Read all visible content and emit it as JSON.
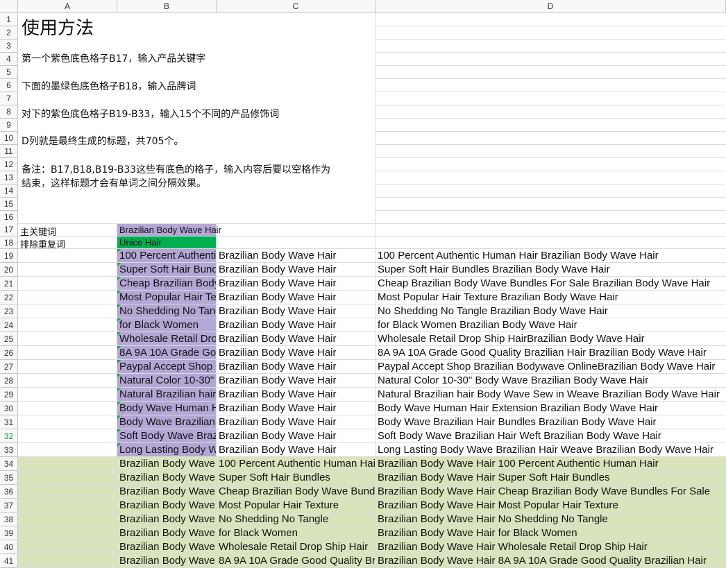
{
  "columns": [
    "A",
    "B",
    "C",
    "D"
  ],
  "rows": [
    1,
    2,
    3,
    4,
    5,
    6,
    7,
    8,
    9,
    10,
    11,
    12,
    13,
    14,
    15,
    16,
    17,
    18,
    19,
    20,
    21,
    22,
    23,
    24,
    25,
    26,
    27,
    28,
    29,
    30,
    31,
    32,
    33,
    34,
    35,
    36,
    37,
    38,
    39,
    40,
    41
  ],
  "active_row": 32,
  "colors": {
    "purple_fill": "#b4a7d6",
    "green_fill": "#00b050",
    "light_green_fill": "#d8e4bc",
    "grid": "#dadcdd",
    "header_bg": "#f8f8f8"
  },
  "instructions": {
    "title": "使用方法",
    "line1": "第一个紫色底色格子B17，输入产品关键字",
    "line2": "下面的墨绿色底色格子B18，输入品牌词",
    "line3": "对下的紫色底色格子B19-B33，输入15个不同的产品修饰词",
    "line4": "D列就是最终生成的标题，共705个。",
    "line5a": "备注：B17,B18,B19-B33这些有底色的格子，输入内容后要以空格作为",
    "line5b": "结束，这样标题才会有单词之间分隔效果。"
  },
  "labels": {
    "main_keyword": "主关键词",
    "exclude_words": "排除重复词"
  },
  "cells": {
    "B17": "Brazilian Body Wave Hair",
    "B18": "Unice Hair",
    "rows19_33": [
      {
        "b": "100 Percent Authentic Human Hair",
        "c": "Brazilian Body Wave Hair",
        "d": "100 Percent Authentic Human Hair Brazilian Body Wave Hair"
      },
      {
        "b": "Super Soft Hair Bundles",
        "c": "Brazilian Body Wave Hair",
        "d": "Super Soft Hair Bundles Brazilian Body Wave Hair"
      },
      {
        "b": "Cheap Brazilian Body Wave Bundles For Sale",
        "c": "Brazilian Body Wave Hair",
        "d": "Cheap Brazilian Body Wave Bundles For Sale Brazilian Body Wave Hair"
      },
      {
        "b": "Most Popular Hair Texture",
        "c": "Brazilian Body Wave Hair",
        "d": "Most Popular Hair Texture Brazilian Body Wave Hair"
      },
      {
        "b": "No Shedding No Tangle",
        "c": "Brazilian Body Wave Hair",
        "d": "No Shedding No Tangle Brazilian Body Wave Hair"
      },
      {
        "b": "for Black Women",
        "c": "Brazilian Body Wave Hair",
        "d": "for Black Women Brazilian Body Wave Hair"
      },
      {
        "b": "Wholesale Retail Drop Ship Hair",
        "c": "Brazilian Body Wave Hair",
        "d": "Wholesale Retail Drop Ship HairBrazilian Body Wave Hair"
      },
      {
        "b": "8A 9A 10A Grade Good Quality Brazilian Hair",
        "c": "Brazilian Body Wave Hair",
        "d": "8A 9A 10A Grade Good Quality Brazilian Hair Brazilian Body Wave Hair"
      },
      {
        "b": "Paypal Accept Shop Brazilian Bodywave Online",
        "c": "Brazilian Body Wave Hair",
        "d": "Paypal Accept Shop Brazilian Bodywave OnlineBrazilian Body Wave Hair"
      },
      {
        "b": "Natural Color 10-30\" Body Wave",
        "c": "Brazilian Body Wave Hair",
        "d": "Natural Color 10-30\" Body Wave Brazilian Body Wave Hair"
      },
      {
        "b": "Natural Brazilian hair Body Wave Sew in Weave",
        "c": "Brazilian Body Wave Hair",
        "d": "Natural Brazilian hair Body Wave Sew in Weave Brazilian Body Wave Hair"
      },
      {
        "b": "Body Wave Human Hair Extension",
        "c": "Brazilian Body Wave Hair",
        "d": "Body Wave Human Hair Extension Brazilian Body Wave Hair"
      },
      {
        "b": "Body Wave Brazilian Hair Bundles",
        "c": "Brazilian Body Wave Hair",
        "d": "Body Wave Brazilian Hair Bundles Brazilian Body Wave Hair"
      },
      {
        "b": "Soft Body Wave Brazilian Hair Weft",
        "c": "Brazilian Body Wave Hair",
        "d": "Soft Body Wave Brazilian Hair Weft Brazilian Body Wave Hair"
      },
      {
        "b": "Long Lasting Body Wave Brazilian Hair Weave",
        "c": "Brazilian Body Wave Hair",
        "d": "Long Lasting Body Wave Brazilian Hair Weave Brazilian Body Wave Hair"
      }
    ],
    "rows34_41": [
      {
        "b": "Brazilian Body Wave Hair",
        "c": "100 Percent Authentic Human Hair",
        "d": "Brazilian Body Wave Hair 100 Percent Authentic Human Hair"
      },
      {
        "b": "Brazilian Body Wave Hair",
        "c": "Super Soft Hair Bundles",
        "d": "Brazilian Body Wave Hair Super Soft Hair Bundles"
      },
      {
        "b": "Brazilian Body Wave Hair",
        "c": "Cheap Brazilian Body Wave Bundles For Sale",
        "d": "Brazilian Body Wave Hair Cheap Brazilian Body Wave Bundles For Sale"
      },
      {
        "b": "Brazilian Body Wave Hair",
        "c": "Most Popular Hair Texture",
        "d": "Brazilian Body Wave Hair Most Popular Hair Texture"
      },
      {
        "b": "Brazilian Body Wave Hair",
        "c": "No Shedding No Tangle",
        "d": "Brazilian Body Wave Hair No Shedding No Tangle"
      },
      {
        "b": "Brazilian Body Wave Hair",
        "c": "for Black Women",
        "d": "Brazilian Body Wave Hair for Black Women"
      },
      {
        "b": "Brazilian Body Wave Hair",
        "c": "Wholesale Retail Drop Ship Hair",
        "d": "Brazilian Body Wave Hair Wholesale Retail Drop Ship Hair"
      },
      {
        "b": "Brazilian Body Wave Hair",
        "c": "8A 9A 10A Grade Good Quality Brazilian Hair",
        "d": "Brazilian Body Wave Hair 8A 9A 10A Grade Good Quality Brazilian Hair"
      }
    ]
  }
}
